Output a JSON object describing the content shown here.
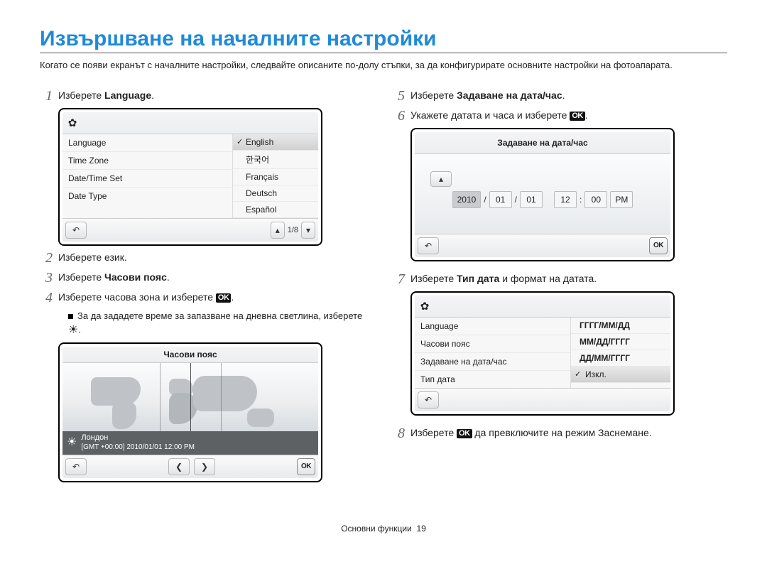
{
  "title": "Извършване на началните настройки",
  "intro": "Когато се появи екранът с началните настройки, следвайте описаните по-долу стъпки, за да конфигурирате основните настройки на фотоапарата.",
  "steps": {
    "s1_prefix": "Изберете ",
    "s1_bold": "Language",
    "s1_suffix": ".",
    "s2": "Изберете език.",
    "s3_prefix": "Изберете ",
    "s3_bold": "Часови пояс",
    "s3_suffix": ".",
    "s4_prefix": "Изберете часова зона и изберете ",
    "s4_suffix": ".",
    "s4_sub_prefix": "За да зададете време за запазване на дневна светлина, изберете ",
    "s4_sub_suffix": ".",
    "s5_prefix": "Изберете ",
    "s5_bold": "Задаване на дата/час",
    "s5_suffix": ".",
    "s6_prefix": "Укажете датата и часа и изберете ",
    "s6_suffix": ".",
    "s7_prefix": "Изберете ",
    "s7_bold": "Тип дата",
    "s7_suffix": " и формат на датата.",
    "s8_prefix": "Изберете ",
    "s8_suffix": " да превключите на режим Заснемане."
  },
  "ok_label": "OK",
  "lang_screen": {
    "left": [
      "Language",
      "Time Zone",
      "Date/Time Set",
      "Date Type"
    ],
    "right": [
      "English",
      "한국어",
      "Français",
      "Deutsch",
      "Español"
    ],
    "page_indicator": "1/8"
  },
  "tz_screen": {
    "title": "Часови пояс",
    "city": "Лондон",
    "detail": "[GMT +00:00]  2010/01/01  12:00 PM"
  },
  "dt_screen": {
    "title": "Задаване на дата/час",
    "year": "2010",
    "month": "01",
    "day": "01",
    "hour": "12",
    "minute": "00",
    "ampm": "PM",
    "slash": "/",
    "colon": ":"
  },
  "type_screen": {
    "left": [
      "Language",
      "Часови пояс",
      "Задаване на дата/час",
      "Тип дата"
    ],
    "right": [
      "ГГГГ/ММ/ДД",
      "ММ/ДД/ГГГГ",
      "ДД/ММ/ГГГГ",
      "Изкл."
    ]
  },
  "footer": {
    "section": "Основни функции",
    "page": "19"
  }
}
